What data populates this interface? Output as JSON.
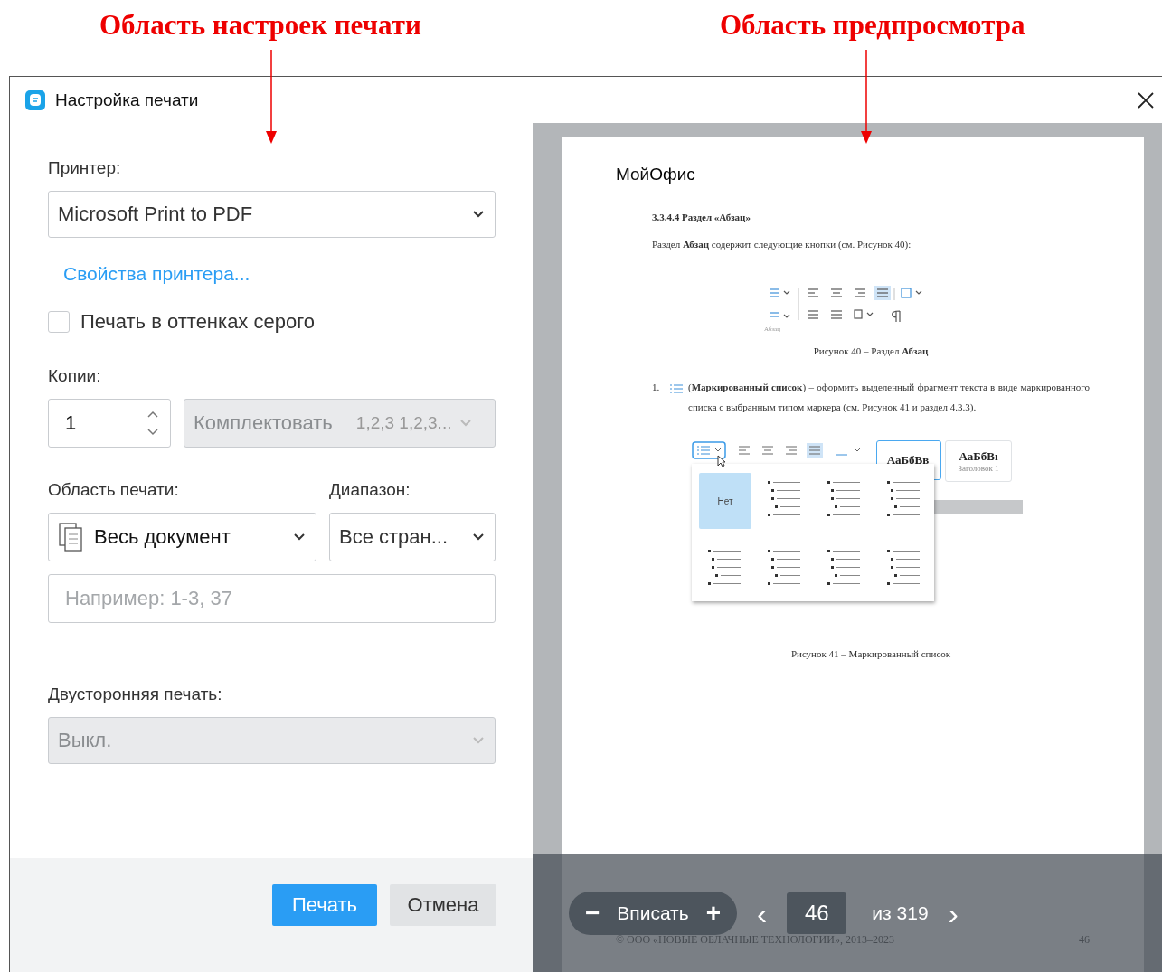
{
  "annotations": [
    {
      "text": "Область настроек печати"
    },
    {
      "text": "Область предпросмотра"
    }
  ],
  "dialog": {
    "title": "Настройка печати",
    "settings": {
      "printer": {
        "label": "Принтер:",
        "value": "Microsoft Print to PDF"
      },
      "printer_properties_link": "Свойства принтера...",
      "grayscale": {
        "label": "Печать в оттенках серого",
        "checked": false
      },
      "copies": {
        "label": "Копии:",
        "value": "1"
      },
      "collate": {
        "label": "Комплектовать",
        "hint": "1,2,3 1,2,3...",
        "disabled": true
      },
      "print_area": {
        "label": "Область печати:",
        "value": "Весь документ"
      },
      "range": {
        "label": "Диапазон:",
        "value": "Все стран..."
      },
      "pages_field": {
        "placeholder": "Например: 1-3, 37"
      },
      "duplex": {
        "label": "Двусторонняя печать:",
        "value": "Выкл.",
        "disabled": true
      },
      "buttons": [
        {
          "label": "Печать",
          "kind": "primary"
        },
        {
          "label": "Отмена",
          "kind": "secondary"
        }
      ]
    },
    "preview": {
      "page": {
        "logo": "Мой**Офис**",
        "heading": "3.3.4.4 Раздел «Абзац»",
        "paragraph": "Раздел **Абзац** содержит следующие кнопки (см. Рисунок 40):",
        "figure1_group_label": "Абзац",
        "figure1_caption": "Рисунок 40 – Раздел **Абзац**",
        "list_item": {
          "number": "1.",
          "text": "(**Маркированный список**) – оформить выделенный фрагмент текста в виде маркированного списка с выбранным типом маркера (см. Рисунок 41 и раздел 4.3.3)."
        },
        "figure2": {
          "style_tiles": [
            {
              "sample": "АаБбВв",
              "selected": true
            },
            {
              "sample": "АаБбВı",
              "caption": "Заголовок 1",
              "selected": false
            }
          ],
          "none_option": "Нет"
        },
        "figure2_caption": "Рисунок 41 – Маркированный список",
        "footer": {
          "copyright": "© ООО «НОВЫЕ ОБЛАЧНЫЕ ТЕХНОЛОГИИ», 2013–2023",
          "page_number": "46"
        }
      },
      "toolbar": {
        "zoom_out": "−",
        "zoom_label": "Вписать",
        "zoom_in": "+",
        "prev": "‹",
        "page": "46",
        "total": "из 319",
        "next": "›"
      }
    }
  }
}
